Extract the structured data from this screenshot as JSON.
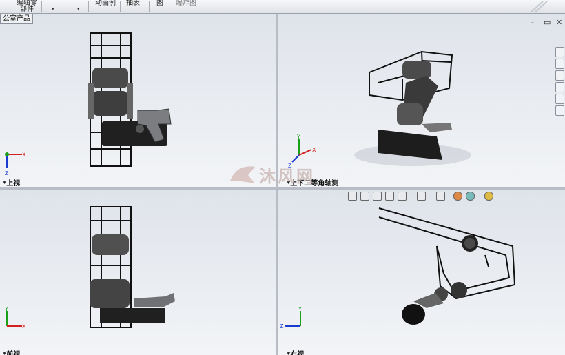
{
  "toolbar": {
    "items": [
      {
        "label": "编辑零\n部件",
        "icon": "edit-part-icon"
      },
      {
        "label": "",
        "icon": "dropdown-icon"
      },
      {
        "label": "动画例",
        "icon": "animation-icon"
      },
      {
        "label": "抽表",
        "icon": "table-icon"
      },
      {
        "label": "图",
        "icon": "drawing-icon"
      },
      {
        "label": "爆炸图",
        "icon": "explode-icon"
      }
    ]
  },
  "tree_tab": {
    "label": "公室产品"
  },
  "views": {
    "top_left": {
      "label": "*上视"
    },
    "top_right": {
      "label": "*上下二等角轴测"
    },
    "bottom_left": {
      "label": "*前视"
    },
    "bottom_right": {
      "label": "*右视"
    }
  },
  "axis": {
    "x": "X",
    "y": "Y",
    "z": "Z"
  },
  "colors": {
    "axis_x": "#d42020",
    "axis_y": "#19a019",
    "axis_z": "#1a3ad0",
    "background_top": "#dfe3ea"
  },
  "watermark": {
    "text": "沐风网"
  }
}
